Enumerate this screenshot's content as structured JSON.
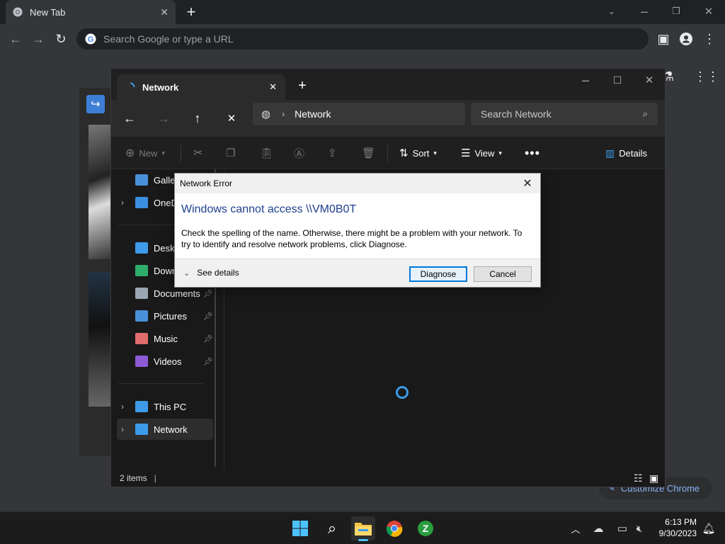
{
  "chrome": {
    "tab_title": "New Tab",
    "omnibox_placeholder": "Search Google or type a URL",
    "customize_label": "Customize Chrome"
  },
  "explorer": {
    "tab_title": "Network",
    "address": "Network",
    "search_placeholder": "Search Network",
    "commands": {
      "new": "New",
      "sort": "Sort",
      "view": "View",
      "details": "Details"
    },
    "sidebar": [
      {
        "label": "Gallery",
        "icon": "gallery-icon",
        "color": "#4a90d9"
      },
      {
        "label": "OneDrive",
        "icon": "onedrive-icon",
        "color": "#3c8fe0",
        "expandable": true
      },
      {
        "label": "Desktop",
        "icon": "desktop-icon",
        "color": "#3d9be9",
        "pinned": true
      },
      {
        "label": "Downloads",
        "icon": "downloads-icon",
        "color": "#2fae6b",
        "pinned": true
      },
      {
        "label": "Documents",
        "icon": "documents-icon",
        "color": "#9aa6b2",
        "pinned": true
      },
      {
        "label": "Pictures",
        "icon": "pictures-icon",
        "color": "#4a90d9",
        "pinned": true
      },
      {
        "label": "Music",
        "icon": "music-icon",
        "color": "#e06c6c",
        "pinned": true
      },
      {
        "label": "Videos",
        "icon": "videos-icon",
        "color": "#8e5bd6",
        "pinned": true
      },
      {
        "label": "This PC",
        "icon": "this-pc-icon",
        "color": "#3d9be9",
        "expandable": true
      },
      {
        "label": "Network",
        "icon": "network-icon",
        "color": "#3d9be9",
        "expandable": true,
        "selected": true
      }
    ],
    "status": "2 items"
  },
  "dialog": {
    "title": "Network Error",
    "main_instruction": "Windows cannot access \\\\VM0B0T",
    "body": "Check the spelling of the name. Otherwise, there might be a problem with your network. To try to identify and resolve network problems, click Diagnose.",
    "see_details": "See details",
    "diagnose": "Diagnose",
    "cancel": "Cancel"
  },
  "taskbar": {
    "time": "6:13 PM",
    "date": "9/30/2023"
  },
  "colors": {
    "accent": "#0078d7",
    "spinner": "#3d9be9",
    "dialog_heading": "#1e3f8f"
  }
}
